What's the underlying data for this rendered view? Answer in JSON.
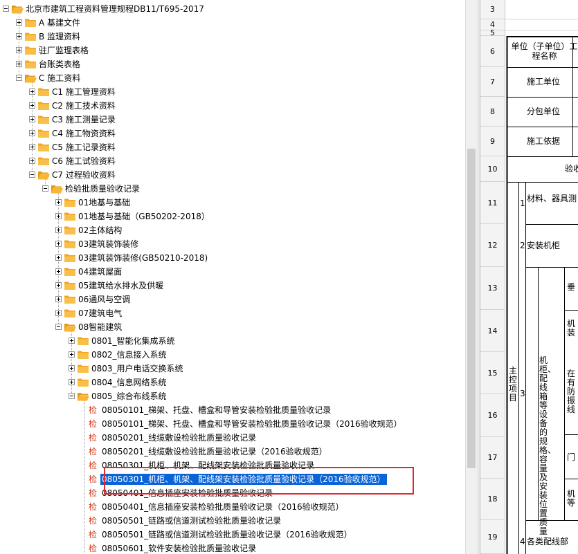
{
  "tree": {
    "root": "北京市建筑工程资料管理规程DB11/T695-2017",
    "groups": [
      "A 基建文件",
      "B 监理资料",
      "驻厂监理表格",
      "台账类表格",
      "C 施工资料"
    ],
    "c_children": [
      "C1 施工管理资料",
      "C2 施工技术资料",
      "C3 施工测量记录",
      "C4 施工物资资料",
      "C5 施工记录资料",
      "C6 施工试验资料",
      "C7 过程验收资料"
    ],
    "c7_child": "检验批质量验收记录",
    "categories": [
      "01地基与基础",
      "01地基与基础（GB50202-2018）",
      "02主体结构",
      "03建筑装饰装修",
      "03建筑装饰装修(GB50210-2018)",
      "04建筑屋面",
      "05建筑给水排水及供暖",
      "06通风与空调",
      "07建筑电气",
      "08智能建筑"
    ],
    "systems": [
      "0801_智能化集成系统",
      "0802_信息接入系统",
      "0803_用户电话交换系统",
      "0804_信息网络系统",
      "0805_综合布线系统"
    ],
    "records_icon": "检",
    "records": [
      "08050101_梯架、托盘、槽盒和导管安装检验批质量验收记录",
      "08050101_梯架、托盘、槽盒和导管安装检验批质量验收记录（2016验收规范）",
      "08050201_线缆敷设检验批质量验收记录",
      "08050201_线缆敷设检验批质量验收记录（2016验收规范）",
      "08050301_机柜、机架、配线架安装检验批质量验收记录",
      "08050301_机柜、机架、配线架安装检验批质量验收记录（2016验收规范）",
      "08050401_信息插座安装检验批质量验收记录",
      "08050401_信息插座安装检验批质量验收记录（2016验收规范）",
      "08050501_链路或信道测试检验批质量验收记录",
      "08050501_链路或信道测试检验批质量验收记录（2016验收规范）",
      "08050601_软件安装检验批质量验收记录"
    ],
    "selected_record_index": 5
  },
  "sheet": {
    "row_headers": [
      "3",
      "4",
      "5",
      "6",
      "7",
      "8",
      "9",
      "10",
      "11",
      "12",
      "13",
      "14",
      "15",
      "16",
      "17",
      "18",
      "19"
    ],
    "labels": {
      "unit": "单位（子单位）工程名称",
      "construction_unit": "施工单位",
      "subcontract_unit": "分包单位",
      "basis": "施工依据",
      "acceptance": "验收",
      "main_control": "主控项目",
      "n1": "1",
      "item1": "材料、器具测",
      "n2": "2",
      "item2": "安装机柜",
      "n3": "3",
      "item3": "机柜、配线箱等设备的规格、容量及安装位置质量",
      "item3a": "垂",
      "item3b": "机装",
      "item3c": "在有防振线",
      "item3d": "门",
      "item3e": "机等",
      "n4": "4",
      "item4": "各类配线部"
    }
  },
  "colors": {
    "selection": "#0a64d8",
    "highlight_box": "#e0282c",
    "folder": "#f3a51f",
    "record_icon": "#d23a1c"
  }
}
